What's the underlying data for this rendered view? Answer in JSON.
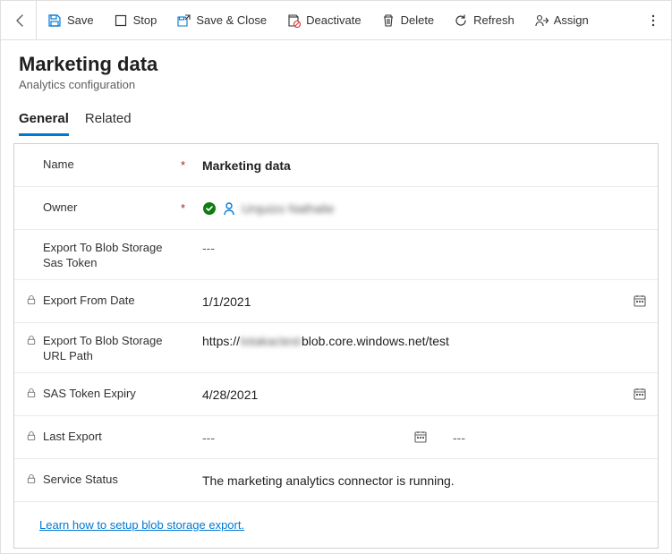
{
  "toolbar": {
    "save": "Save",
    "stop": "Stop",
    "saveClose": "Save & Close",
    "deactivate": "Deactivate",
    "delete": "Delete",
    "refresh": "Refresh",
    "assign": "Assign"
  },
  "header": {
    "title": "Marketing data",
    "subtitle": "Analytics configuration"
  },
  "tabs": {
    "general": "General",
    "related": "Related"
  },
  "fields": {
    "name": {
      "label": "Name",
      "required": "*",
      "value": "Marketing data"
    },
    "owner": {
      "label": "Owner",
      "required": "*",
      "value": "Urquizo Nathalie"
    },
    "sasToken": {
      "label": "Export To Blob Storage Sas Token",
      "value": "---"
    },
    "exportFrom": {
      "label": "Export From Date",
      "value": "1/1/2021"
    },
    "urlPath": {
      "label": "Export To Blob Storage URL Path",
      "prefix": "https://",
      "hidden": "lotakactest",
      "suffix": "blob.core.windows.net/test"
    },
    "sasExpiry": {
      "label": "SAS Token Expiry",
      "value": "4/28/2021"
    },
    "lastExport": {
      "label": "Last Export",
      "value1": "---",
      "value2": "---"
    },
    "serviceStatus": {
      "label": "Service Status",
      "value": "The marketing analytics connector is running."
    }
  },
  "footer": {
    "link": "Learn how to setup blob storage export."
  }
}
